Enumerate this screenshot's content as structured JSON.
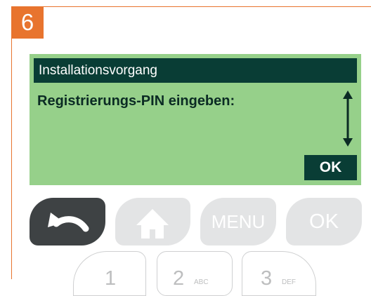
{
  "step": {
    "number": "6"
  },
  "screen": {
    "title": "Installationsvorgang",
    "prompt": "Registrierungs-PIN eingeben:",
    "softkey_ok": "OK"
  },
  "keypad": {
    "menu_label": "MENU",
    "ok_label": "OK",
    "digits": [
      {
        "digit": "1",
        "letters": ""
      },
      {
        "digit": "2",
        "letters": "ABC"
      },
      {
        "digit": "3",
        "letters": "DEF"
      }
    ]
  },
  "icons": {
    "back": "back-arrow-icon",
    "home": "home-icon",
    "scroll": "scroll-updown-icon"
  },
  "colors": {
    "accent": "#e8742e",
    "screen_bg": "#96d08a",
    "screen_dark": "#093d35",
    "key_dark": "#3e4244",
    "key_light": "#e3e4e5"
  }
}
